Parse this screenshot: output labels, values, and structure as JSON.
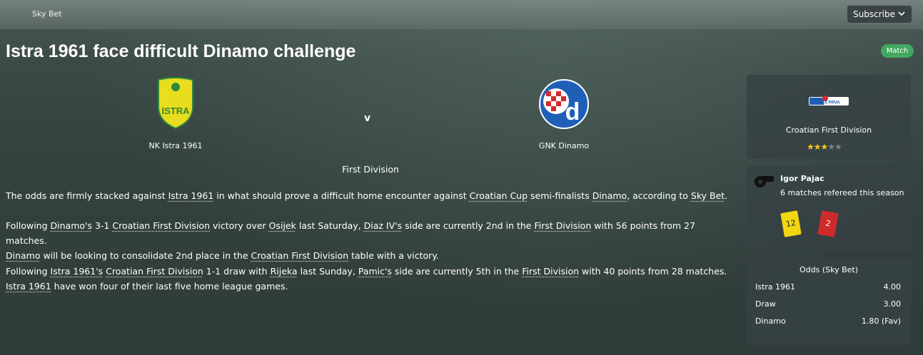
{
  "topbar": {
    "source": "Sky Bet",
    "subscribe_label": "Subscribe"
  },
  "article": {
    "headline": "Istra 1961 face difficult Dinamo challenge",
    "badge": "Match",
    "home_team": "NK Istra 1961",
    "home_logo_text": "ISTRA",
    "away_team": "GNK Dinamo",
    "away_logo_text": "d",
    "versus": "v",
    "competition": "First Division",
    "p1": {
      "t1": "The odds are firmly stacked against ",
      "l1": "Istra 1961",
      "t2": " in what should prove a difficult home encounter against ",
      "l2": "Croatian Cup",
      "t3": " semi-finalists ",
      "l3": "Dinamo",
      "t4": ", according to ",
      "l4": "Sky Bet",
      "t5": "."
    },
    "p2": {
      "t1": "Following ",
      "l1": "Dinamo's",
      "t2": " 3-1 ",
      "l2": "Croatian First Division",
      "t3": " victory over ",
      "l3": "Osijek",
      "t4": " last Saturday, ",
      "l4": "Diaz IV's",
      "t5": " side are currently 2nd in the ",
      "l5": "First Division",
      "t6": " with 56 points from 27 matches.",
      "l6": "Dinamo",
      "t7": " will be looking to consolidate 2nd place in the ",
      "l7": "Croatian First Division",
      "t8": " table with a victory."
    },
    "p3": {
      "t1": "Following ",
      "l1": "Istra 1961's",
      "t2": " ",
      "l2": "Croatian First Division",
      "t3": " 1-1 draw with ",
      "l3": "Rijeka",
      "t4": " last Sunday, ",
      "l4": "Pamic's",
      "t5": " side are currently 5th in the ",
      "l5": "First Division",
      "t6": " with 40 points from 28 matches. ",
      "l6": "Istra 1961",
      "t7": " have won four of their last five home league games."
    }
  },
  "competition_panel": {
    "logo_text": "MAX PRVA",
    "name": "Croatian First Division",
    "rating_stars": 3,
    "rating_max": 5
  },
  "referee_panel": {
    "name": "Igor Pajac",
    "stats": "6 matches refereed this season",
    "yellow_cards": "12",
    "red_cards": "2"
  },
  "odds_panel": {
    "title": "Odds (Sky Bet)",
    "rows": [
      {
        "label": "Istra 1961",
        "value": "4.00"
      },
      {
        "label": "Draw",
        "value": "3.00"
      },
      {
        "label": "Dinamo",
        "value": "1.80 (Fav)"
      }
    ]
  },
  "colors": {
    "badge": "#41a85f",
    "istra_yellow": "#e8dd1e",
    "istra_green": "#2e8a3a",
    "dinamo_blue": "#1f5fb8",
    "dinamo_red": "#d42a2a",
    "star_on": "#f5c518",
    "yellow_card": "#f2d60f",
    "red_card": "#cc2b2b"
  },
  "icons": [
    "chevron-down-icon",
    "whistle-icon",
    "star-icon"
  ]
}
